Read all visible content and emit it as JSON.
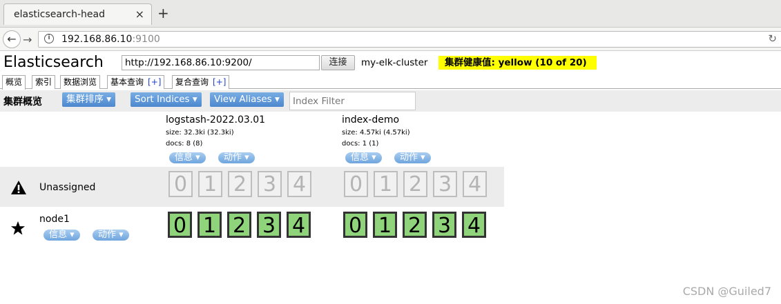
{
  "browser": {
    "tab_title": "elasticsearch-head",
    "tab_close": "×",
    "new_tab": "+",
    "url_host": "192.168.86.10",
    "url_port": ":9100"
  },
  "app": {
    "title": "Elasticsearch",
    "connect_url": "http://192.168.86.10:9200/",
    "connect_button": "连接",
    "cluster_name": "my-elk-cluster",
    "health": "集群健康值: yellow (10 of 20)",
    "health_color": "#ffff00"
  },
  "tabs": [
    {
      "label": "概览"
    },
    {
      "label": "索引"
    },
    {
      "label": "数据浏览"
    },
    {
      "label": "基本查询",
      "plus": "[+]"
    },
    {
      "label": "复合查询",
      "plus": "[+]"
    }
  ],
  "toolbar": {
    "label": "集群概览",
    "sort_cluster": "集群排序",
    "sort_indices": "Sort Indices",
    "view_aliases": "View Aliases",
    "index_filter_placeholder": "Index Filter"
  },
  "indices": [
    {
      "name": "logstash-2022.03.01",
      "size": "size: 32.3ki (32.3ki)",
      "docs": "docs: 8 (8)",
      "info": "信息",
      "action": "动作"
    },
    {
      "name": "index-demo",
      "size": "size: 4.57ki (4.57ki)",
      "docs": "docs: 1 (1)",
      "info": "信息",
      "action": "动作"
    }
  ],
  "rows": {
    "unassigned_label": "Unassigned",
    "node_label": "node1",
    "node_info": "信息",
    "node_action": "动作"
  },
  "shards": [
    "0",
    "1",
    "2",
    "3",
    "4"
  ],
  "shard_assigned_color": "#8fd47a",
  "watermark": "CSDN @Guiled7"
}
